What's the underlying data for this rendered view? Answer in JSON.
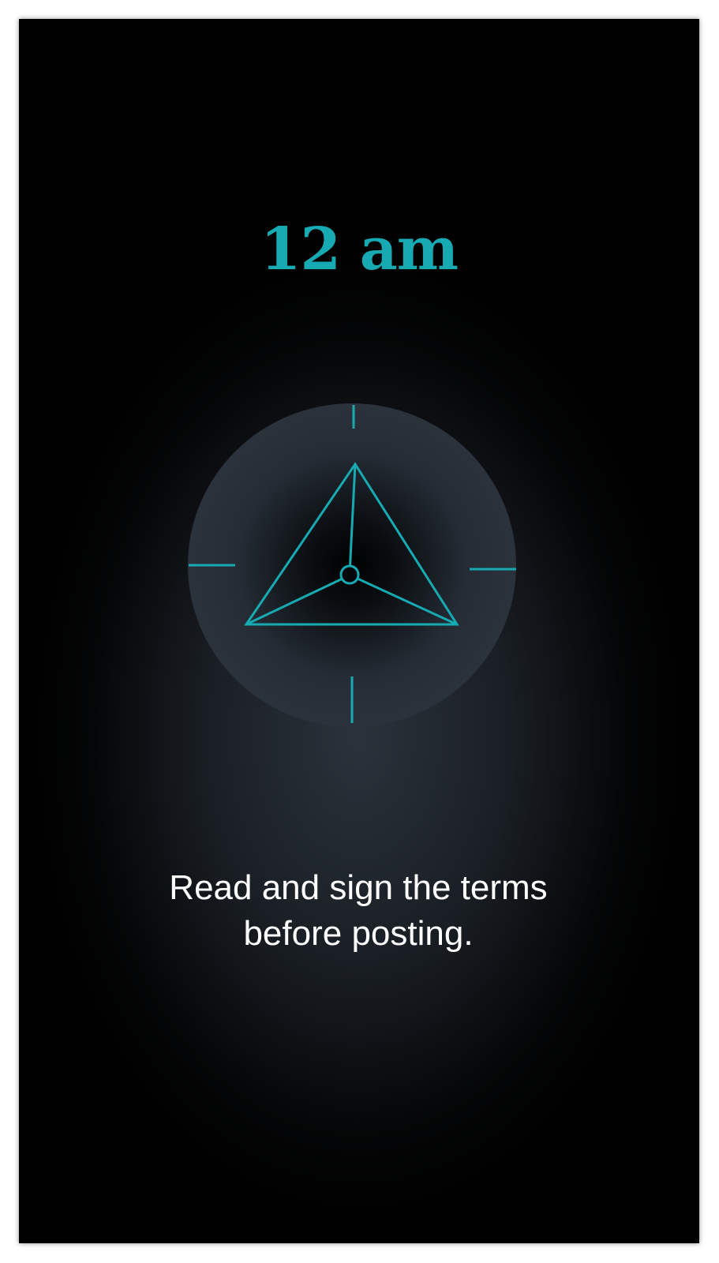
{
  "screen": {
    "time_label": "12 am",
    "message_line1": "Read and sign the terms",
    "message_line2": "before posting."
  },
  "colors": {
    "accent": "#17aab2",
    "background": "#000000",
    "dial_glow": "#2b323b",
    "text": "#ffffff"
  },
  "icons": {
    "dial": "triangle-compass-icon"
  }
}
